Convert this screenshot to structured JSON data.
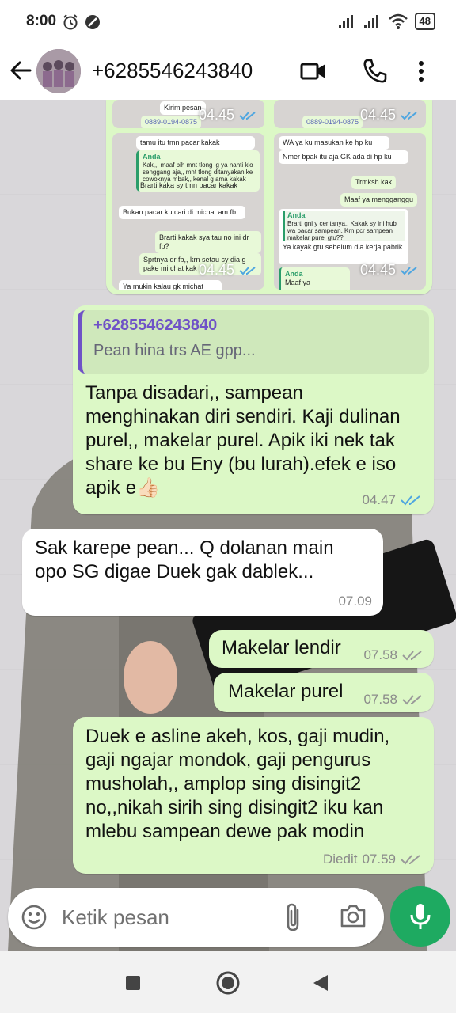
{
  "status_bar": {
    "time": "8:00",
    "battery": "48"
  },
  "header": {
    "contact": "+6285546243840"
  },
  "album": {
    "tiles": [
      {
        "time": "04.45"
      },
      {
        "time": "04.45"
      },
      {
        "time": "04.45"
      },
      {
        "time": "04.45"
      }
    ],
    "snippets": {
      "t1_top": "Kirim pesan",
      "t1_num": "0889-0194-0875",
      "t2_num": "0889-0194-0875",
      "t3_line1": "tamu itu tmn pacar kakak",
      "t3_anda": "Anda",
      "t3_quote": "Kak,,, maaf bih mnt tlong lg ya nanti klo senggang aja,, mnt tlong ditanyakan ke cowoknya mbak,, kenal g ama kakak",
      "t3_reply": "Brarti kaka sy tmn pacar kakak",
      "t3_in1": "Bukan pacar ku cari di michat am fb",
      "t3_out1": "Brarti kakak sya tau no ini dr fb?",
      "t3_out2": "Sprtnya dr fb,, krn setau sy dia g pake mi chat kak",
      "t3_in2": "Ya mukin kalau gk michat",
      "t4_line1": "WA ya ku masukan ke hp ku",
      "t4_line2": "Nmer bpak itu aja GK ada di hp ku",
      "t4_out1": "Trmksh kak",
      "t4_out2": "Maaf ya mengganggu",
      "t4_anda": "Anda",
      "t4_quote": "Brarti gni y ceritanya,, Kakak sy ini hub wa pacar sampean. Krn pcr sampean makelar purel gtu??",
      "t4_in": "Ya kayak gtu sebelum dia kerja pabrik",
      "t4_anda2": "Anda",
      "t4_quote2": "Maaf ya mengganggu"
    }
  },
  "messages": [
    {
      "dir": "out",
      "quote_name": "+6285546243840",
      "quote_text": "Pean hina trs AE gpp...",
      "text": "Tanpa disadari,, sampean menghinakan diri sendiri. Kaji dulinan purel,, makelar purel. Apik iki nek tak share ke bu Eny (bu lurah).efek e iso apik e👍🏻",
      "time": "04.47"
    },
    {
      "dir": "in",
      "text": "Sak karepe pean... Q dolanan main opo SG digae Duek gak dablek...",
      "time": "07.09"
    },
    {
      "dir": "out",
      "text": "Makelar lendir",
      "time": "07.58"
    },
    {
      "dir": "out",
      "text": "Makelar purel",
      "time": "07.58"
    },
    {
      "dir": "out",
      "text": "Duek e asline akeh, kos, gaji mudin, gaji ngajar mondok, gaji pengurus musholah,, amplop sing  disingit2 no,,nikah sirih sing disingit2 iku kan mlebu sampean dewe pak modin",
      "edited": "Diedit",
      "time": "07.59"
    }
  ],
  "input": {
    "placeholder": "Ketik pesan"
  },
  "colors": {
    "outgoing": "#dcf8c6",
    "incoming": "#ffffff",
    "tick_read": "#4fa6e0",
    "mic": "#1eaa61"
  }
}
